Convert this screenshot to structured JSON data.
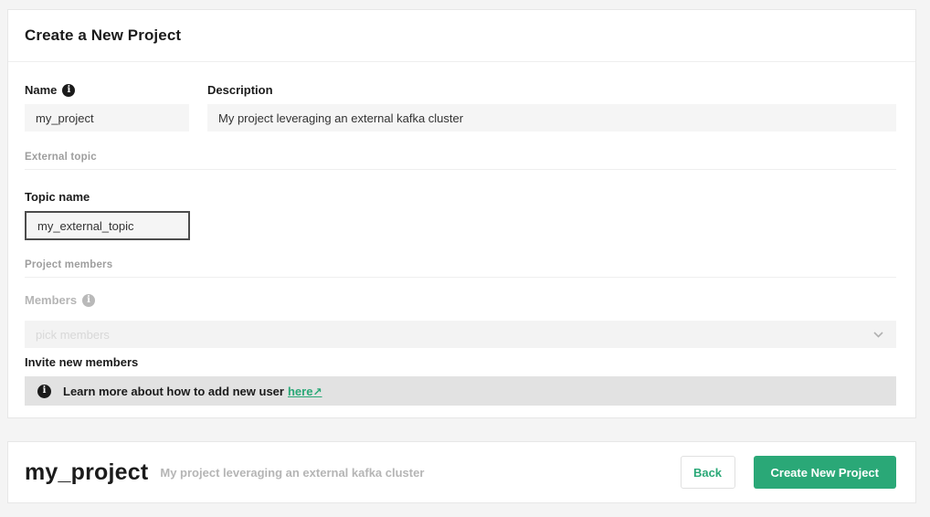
{
  "page": {
    "title": "Create a New Project"
  },
  "form": {
    "name": {
      "label": "Name",
      "value": "my_project"
    },
    "description": {
      "label": "Description",
      "value": "My project leveraging an external kafka cluster"
    },
    "sections": {
      "external_topic": "External topic",
      "project_members": "Project members"
    },
    "topic_name": {
      "label": "Topic name",
      "value": "my_external_topic"
    },
    "members": {
      "label": "Members",
      "placeholder": "pick members"
    },
    "invite": {
      "label": "Invite new members",
      "banner_text": "Learn more about how to add new user",
      "link_text": "here"
    }
  },
  "footer": {
    "project_name": "my_project",
    "project_description": "My project leveraging an external kafka cluster",
    "back_label": "Back",
    "create_label": "Create New Project"
  },
  "icons": {
    "info": "i",
    "external_link": "↗"
  },
  "colors": {
    "accent_green": "#2aa877",
    "banner_background": "#e2e2e2",
    "input_background": "#f5f5f5",
    "muted_text": "#9e9e9e"
  }
}
